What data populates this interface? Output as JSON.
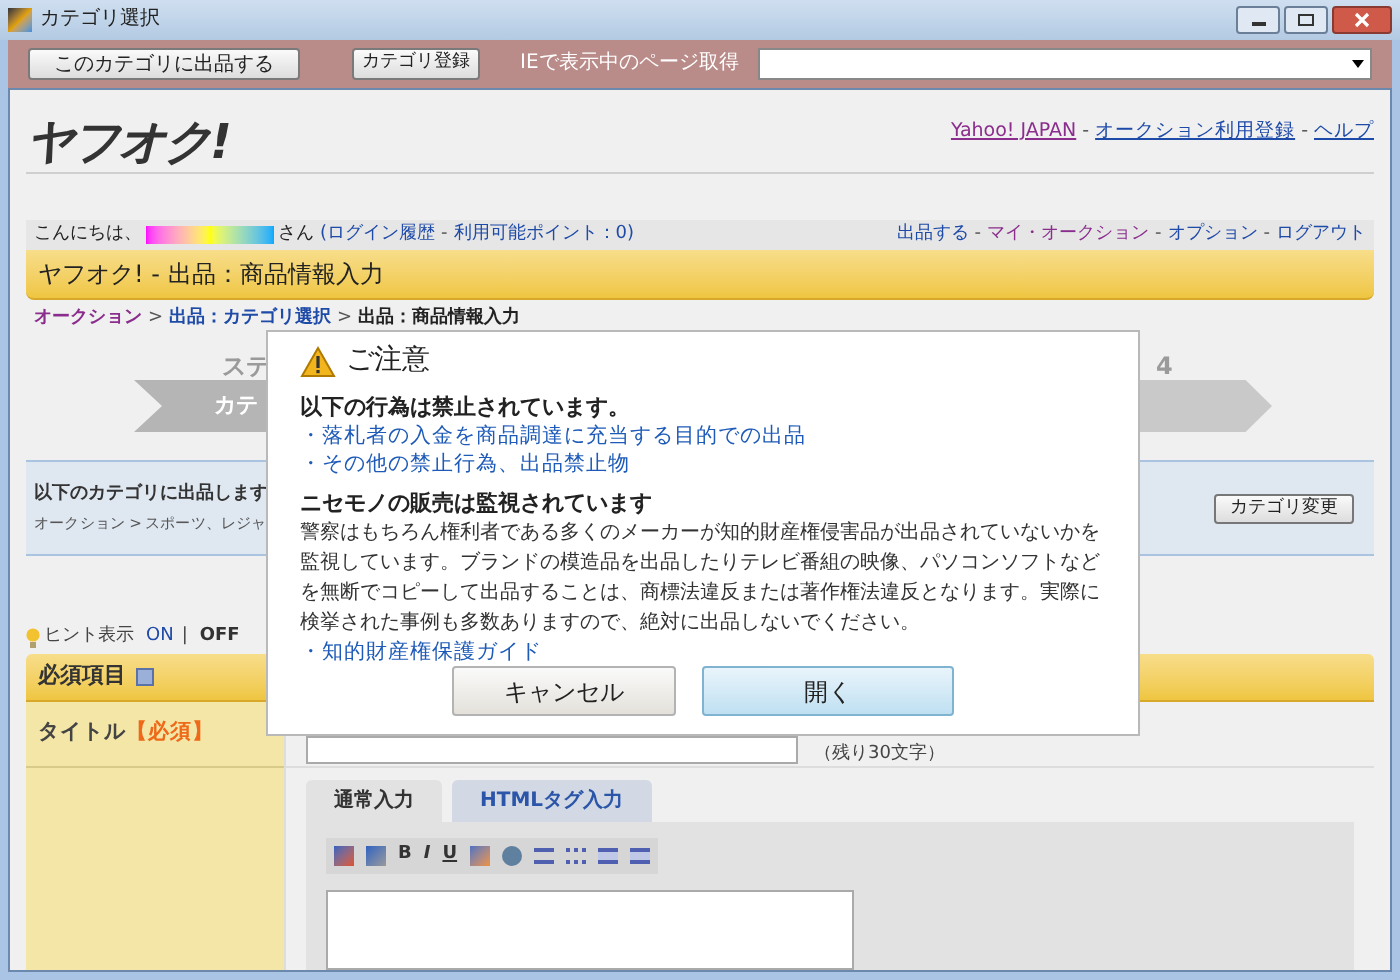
{
  "window": {
    "title": "カテゴリ選択"
  },
  "toolbar": {
    "buttons": [
      "このカテゴリに出品する",
      "カテゴリ登録"
    ],
    "url_label": "IEで表示中のページ取得"
  },
  "header": {
    "logo": "ヤフオク!",
    "links": [
      "Yahoo! JAPAN",
      "オークション利用登録",
      "ヘルプ"
    ],
    "separator": "-"
  },
  "user_bar": {
    "greeting": "こんにちは、",
    "suffix": "さん",
    "links_prefix": "(",
    "links": [
      "ログイン履歴",
      "利用可能ポイント：0"
    ],
    "links_suffix": ")",
    "menu": [
      "出品する",
      "マイ・オークション",
      "オプション",
      "ログアウト"
    ],
    "separator": "-"
  },
  "page_title": "ヤフオク! - 出品：商品情報入力",
  "breadcrumb": {
    "separator": ">",
    "items": [
      {
        "label": "オークション",
        "kind": "visited"
      },
      {
        "label": "出品：カテゴリ選択",
        "kind": "link"
      },
      {
        "label": "出品：商品情報入力",
        "kind": "current"
      }
    ]
  },
  "steps": {
    "left_label": "ステ",
    "left_arrow": "カテ",
    "right_label": "4"
  },
  "category_box": {
    "heading": "以下のカテゴリに出品します",
    "path": "オークション > スポーツ、レジャ",
    "button": "カテゴリ変更"
  },
  "hint": {
    "label": "ヒント表示",
    "separator": "|",
    "options": [
      {
        "label": "ON",
        "selected": false
      },
      {
        "label": "OFF",
        "selected": true
      }
    ]
  },
  "required_section": {
    "title": "必須項目"
  },
  "title_row": {
    "label": "タイトル",
    "badge": "【必須】",
    "remaining": "（残り30文字）"
  },
  "editor": {
    "tabs": [
      {
        "label": "通常入力",
        "selected": true
      },
      {
        "label": "HTMLタグ入力",
        "selected": false
      }
    ],
    "format_buttons": [
      "B",
      "I",
      "U"
    ]
  },
  "dialog": {
    "title": "ご注意",
    "bullet": "・",
    "sections": [
      {
        "heading": "以下の行為は禁止されています。",
        "links": [
          "落札者の入金を商品調達に充当する目的での出品",
          "その他の禁止行為、出品禁止物"
        ]
      },
      {
        "heading": "ニセモノの販売は監視されています",
        "body": "警察はもちろん権利者である多くのメーカーが知的財産権侵害品が出品されていないかを監視しています。ブランドの模造品を出品したりテレビ番組の映像、パソコンソフトなどを無断でコピーして出品することは、商標法違反または著作権法違反となります。実際に検挙された事例も多数ありますので、絶対に出品しないでください。",
        "links": [
          "知的財産権保護ガイド"
        ]
      }
    ],
    "buttons": [
      {
        "label": "キャンセル",
        "kind": "secondary"
      },
      {
        "label": "開く",
        "kind": "primary"
      }
    ]
  }
}
